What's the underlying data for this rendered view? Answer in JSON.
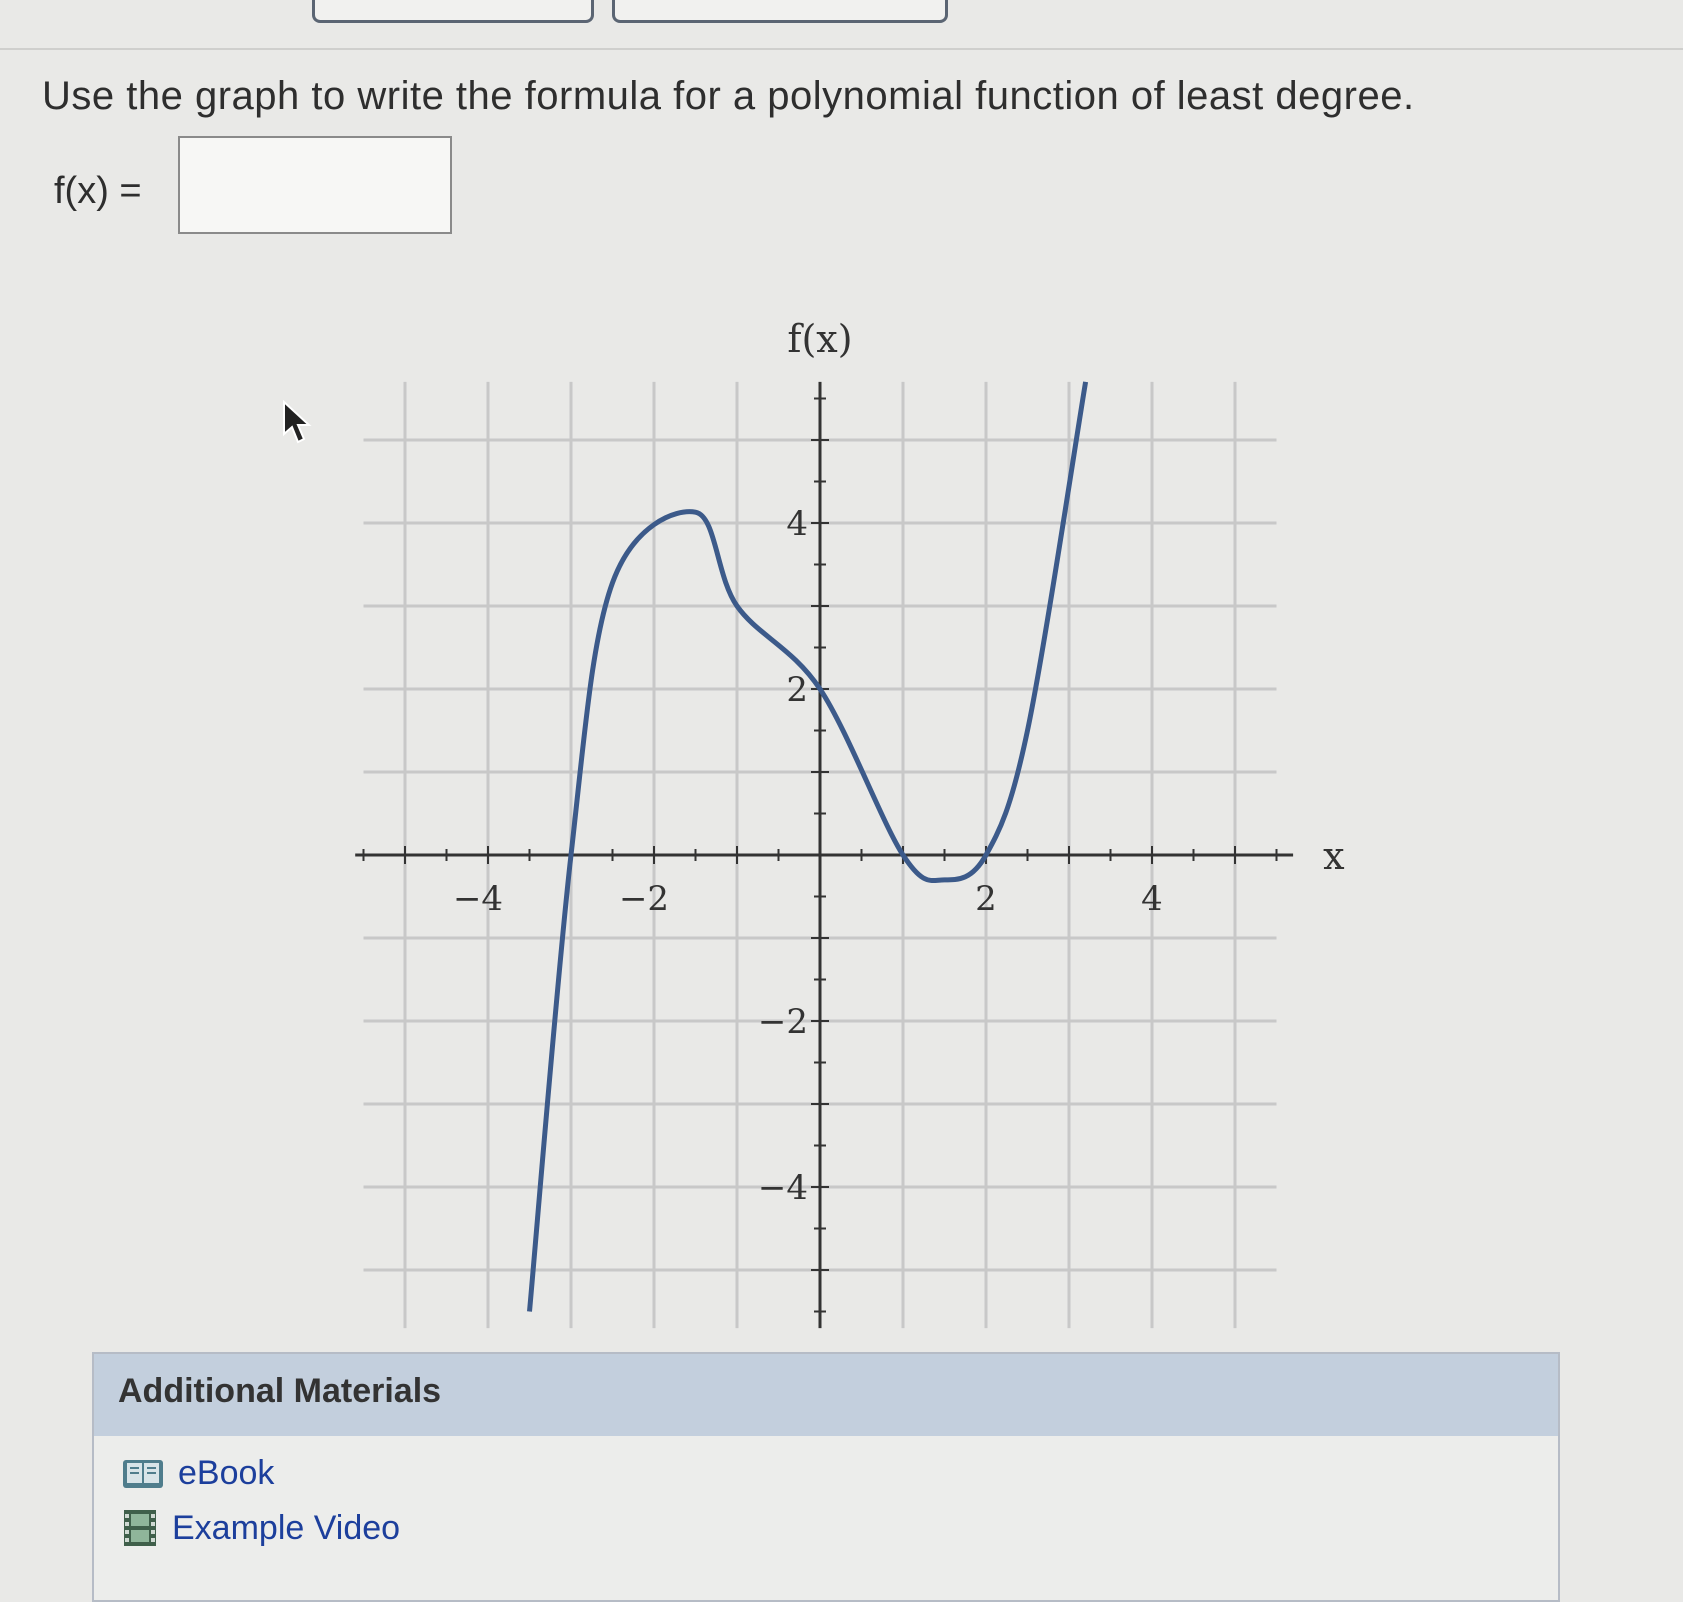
{
  "question": {
    "prompt": "Use the graph to write the formula for a polynomial function of least degree.",
    "fx_label": "f(x) =",
    "answer": {
      "value": "",
      "placeholder": ""
    }
  },
  "graph": {
    "type": "line",
    "y_axis_title": "f(x)",
    "x_axis_title": "x",
    "xlim": [
      -5.5,
      5.5
    ],
    "ylim": [
      -5.5,
      5.5
    ],
    "grid": true,
    "x_tick_labels": [
      {
        "value": -4,
        "label": "−4"
      },
      {
        "value": -2,
        "label": "−2"
      },
      {
        "value": 2,
        "label": "2"
      },
      {
        "value": 4,
        "label": "4"
      }
    ],
    "y_tick_labels": [
      {
        "value": 4,
        "label": "4"
      },
      {
        "value": 2,
        "label": "2"
      },
      {
        "value": -2,
        "label": "−2"
      },
      {
        "value": -4,
        "label": "−4"
      }
    ],
    "line_color": "#3c5a8a"
  },
  "chart_data": {
    "type": "line",
    "title": "",
    "xlabel": "x",
    "ylabel": "f(x)",
    "xlim": [
      -5.5,
      5.5
    ],
    "ylim": [
      -5.5,
      5.5
    ],
    "x_ticks": [
      -4,
      -2,
      2,
      4
    ],
    "y_ticks": [
      -4,
      -2,
      2,
      4
    ],
    "grid": true,
    "series": [
      {
        "points": [
          [
            -3.5,
            -5.5
          ],
          [
            -3.0,
            0.0
          ],
          [
            -2.5,
            3.28
          ],
          [
            -1.5,
            4.13
          ],
          [
            -1.0,
            3.0
          ],
          [
            0.0,
            2.0
          ],
          [
            1.0,
            0.0
          ],
          [
            1.5,
            -0.3
          ],
          [
            2.0,
            0.0
          ],
          [
            2.5,
            1.5
          ],
          [
            3.2,
            5.7
          ]
        ]
      }
    ]
  },
  "additional_materials": {
    "title": "Additional Materials",
    "items": [
      {
        "label": "eBook",
        "icon": "book-icon"
      },
      {
        "label": "Example Video",
        "icon": "film-icon"
      }
    ]
  },
  "colors": {
    "background": "#e9e9e7",
    "panel_header": "#c3cfdd",
    "link": "#1c3f9c",
    "curve": "#3c5a8a"
  }
}
